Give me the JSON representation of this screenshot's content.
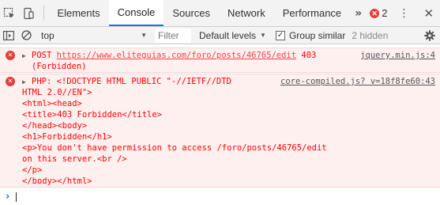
{
  "tabs": [
    {
      "label": "Elements"
    },
    {
      "label": "Console",
      "active": true
    },
    {
      "label": "Sources"
    },
    {
      "label": "Network"
    },
    {
      "label": "Performance"
    }
  ],
  "more_tabs": "»",
  "error_count": "2",
  "error_badge_glyph": "✕",
  "toolbar": {
    "context": "top",
    "filter_placeholder": "Filter",
    "levels": "Default levels",
    "group_similar": "Group similar",
    "group_similar_checked": true,
    "hidden": "2 hidden"
  },
  "messages": [
    {
      "type": "error",
      "prefix": "POST",
      "url": "https://www.eliteguias.com/foro/posts/46765/edit",
      "status": "403",
      "status_text": "(Forbidden)",
      "source": "jquery.min.js:4"
    },
    {
      "type": "error",
      "first_line": "PHP: <!DOCTYPE HTML PUBLIC \"-//IETF//DTD",
      "second_line": "HTML 2.0//EN\">",
      "source": "core-compiled.js? v=18f8fe60:43",
      "lines": [
        "<html><head>",
        "<title>403 Forbidden</title>",
        "</head><body>",
        "<h1>Forbidden</h1>",
        "<p>You don't have permission to access /foro/posts/46765/edit",
        "on this server.<br />",
        "</p>",
        "</body></html>"
      ]
    }
  ],
  "colors": {
    "error_text": "#ff0000",
    "error_bg": "#fff0f0",
    "accent": "#1a73e8",
    "error_badge": "#e0403a"
  }
}
